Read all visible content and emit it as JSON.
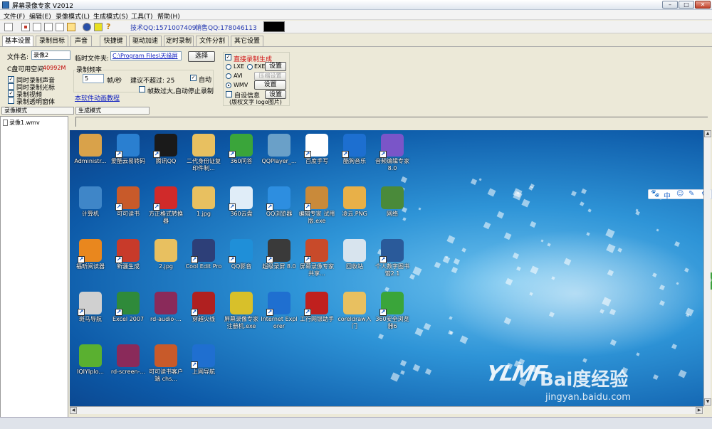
{
  "window": {
    "title": "屏幕录像专家 V2012"
  },
  "menu": [
    "文件(F)",
    "编辑(E)",
    "录像模式(L)",
    "生成模式(S)",
    "工具(T)",
    "帮助(H)"
  ],
  "toolbar": {
    "tech_qq": "技术QQ:1571007409",
    "sales_qq": "销售QQ:178046113"
  },
  "tabs": [
    "基本设置",
    "录制目标",
    "声音",
    "快捷键",
    "驱动加速",
    "定时录制",
    "文件分割",
    "其它设置"
  ],
  "basic": {
    "filename_label": "文件名:",
    "filename_value": "录像2",
    "disk_label": "C盘可用空间",
    "disk_value": "40992M",
    "checks": [
      {
        "label": "同时录制声音",
        "checked": true
      },
      {
        "label": "同时录制光标",
        "checked": true
      },
      {
        "label": "录制视频",
        "checked": true
      },
      {
        "label": "录制透明窗体",
        "checked": false
      }
    ],
    "temp_label": "临时文件夹:",
    "temp_value": "C:\\Program Files\\天缘屏",
    "browse_button": "选择",
    "freq_group": "录制频率",
    "fps_value": "5",
    "fps_unit": "帧/秒",
    "suggest_label": "建议不超过: 25",
    "auto_label": "自动",
    "auto_stop_label": "帧数过大,自动停止录制",
    "tutorial_link": "本软件动画教程"
  },
  "output": {
    "direct_label": "直接录制生成",
    "formats": [
      {
        "label": "LXE",
        "selected": false
      },
      {
        "label": "EXE",
        "selected": false
      },
      {
        "label": "AVI",
        "selected": false
      },
      {
        "label": "WMV",
        "selected": true
      }
    ],
    "settings_button": "设置",
    "compress_button": "压缩设置",
    "info_label": "自设信息",
    "copyright_label": "(版权文字 logo图片)"
  },
  "modes": {
    "record_mode": "录像模式",
    "gen_mode": "生成模式"
  },
  "files": [
    {
      "name": "录像1.wmv"
    }
  ],
  "desktop_icons": [
    {
      "label": "Administr...",
      "color": "#d9a24a",
      "sc": false
    },
    {
      "label": "爱酷云易转码",
      "color": "#2a7fd0",
      "sc": true
    },
    {
      "label": "腾讯QQ",
      "color": "#1a1a1a",
      "sc": true
    },
    {
      "label": "二代身份证复印件制...",
      "color": "#e8c060",
      "sc": false
    },
    {
      "label": "360问答",
      "color": "#3aa53a",
      "sc": true
    },
    {
      "label": "QQPlayer_...",
      "color": "#6aa0c8",
      "sc": false
    },
    {
      "label": "百度手写",
      "color": "#ffffff",
      "sc": true
    },
    {
      "label": "酷狗音乐",
      "color": "#1d6fd0",
      "sc": true
    },
    {
      "label": "音频编辑专家 8.0",
      "color": "#7a55c8",
      "sc": true
    },
    {
      "label": "计算机",
      "color": "#3f86c8",
      "sc": false
    },
    {
      "label": "可可读书",
      "color": "#c85a2a",
      "sc": true
    },
    {
      "label": "方正格式转换器",
      "color": "#d02a2a",
      "sc": true
    },
    {
      "label": "1.jpg",
      "color": "#e8c060",
      "sc": false
    },
    {
      "label": "360云盘",
      "color": "#e0edf8",
      "sc": true
    },
    {
      "label": "QQ浏览器",
      "color": "#2d8ee0",
      "sc": true
    },
    {
      "label": "编辑专家 试用版.exe",
      "color": "#c98a3a",
      "sc": true
    },
    {
      "label": "凌云.PNG",
      "color": "#e8b048",
      "sc": false
    },
    {
      "label": "网络",
      "color": "#4a8a3a",
      "sc": false
    },
    {
      "label": "福昕阅读器",
      "color": "#e9871e",
      "sc": true
    },
    {
      "label": "新疆生成",
      "color": "#c83a2a",
      "sc": true
    },
    {
      "label": "2.jpg",
      "color": "#e8c060",
      "sc": false
    },
    {
      "label": "Cool Edit Pro",
      "color": "#2d3f78",
      "sc": true
    },
    {
      "label": "QQ影音",
      "color": "#1f8fd8",
      "sc": true
    },
    {
      "label": "超级录屏 8.0",
      "color": "#3a3a3a",
      "sc": true
    },
    {
      "label": "屏幕录像专家 共享...",
      "color": "#c84a2a",
      "sc": true
    },
    {
      "label": "回收站",
      "color": "#d8e4ee",
      "sc": false
    },
    {
      "label": "个人数字图书馆2.1",
      "color": "#2a5a9a",
      "sc": true
    },
    {
      "label": "斑马导航",
      "color": "#d0d0d0",
      "sc": true
    },
    {
      "label": "Excel 2007",
      "color": "#2f8a3a",
      "sc": true
    },
    {
      "label": "rd-audio-...",
      "color": "#8a2a5a",
      "sc": false
    },
    {
      "label": "穿越火线",
      "color": "#b02020",
      "sc": true
    },
    {
      "label": "屏幕录像专家注册机.exe",
      "color": "#d8c02a",
      "sc": false
    },
    {
      "label": "Internet Explorer",
      "color": "#1f6fd0",
      "sc": true
    },
    {
      "label": "工行网银助手",
      "color": "#c0201e",
      "sc": true
    },
    {
      "label": "coreldraw入门",
      "color": "#e8c060",
      "sc": false
    },
    {
      "label": "360安全浏览器6",
      "color": "#3aa53a",
      "sc": true
    },
    {
      "label": "IQIYIplo...",
      "color": "#5ab030",
      "sc": false
    },
    {
      "label": "rd-screen-...",
      "color": "#8a2a5a",
      "sc": false
    },
    {
      "label": "可可读书客户端 chs...",
      "color": "#c85a2a",
      "sc": false
    },
    {
      "label": "上网导航",
      "color": "#1f6fd0",
      "sc": true
    }
  ],
  "watermark": {
    "brand": "YLMF",
    "baidu": "Bai度经验",
    "url": "jingyan.baidu.com"
  },
  "floatbar": [
    "🐾",
    "中",
    "☺",
    "✎",
    "⚙"
  ],
  "green_ball": "49"
}
